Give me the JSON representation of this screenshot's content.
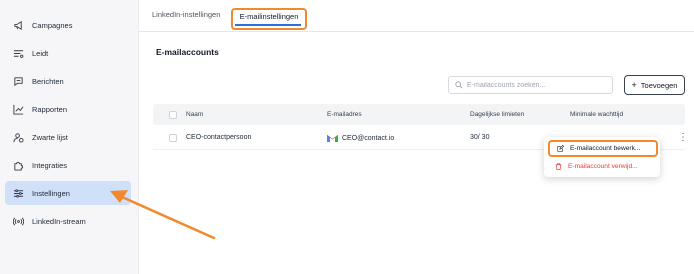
{
  "sidebar": {
    "items": [
      {
        "label": "Campagnes",
        "icon": "megaphone-icon"
      },
      {
        "label": "Leidt",
        "icon": "list-filter-icon"
      },
      {
        "label": "Berichten",
        "icon": "chat-bubble-icon"
      },
      {
        "label": "Rapporten",
        "icon": "chart-icon"
      },
      {
        "label": "Zwarte lijst",
        "icon": "user-block-icon"
      },
      {
        "label": "Integraties",
        "icon": "puzzle-icon"
      },
      {
        "label": "Instellingen",
        "icon": "sliders-icon",
        "active": true
      },
      {
        "label": "LinkedIn-stream",
        "icon": "broadcast-icon"
      }
    ]
  },
  "tabs": [
    {
      "label": "LinkedIn-instellingen"
    },
    {
      "label": "E-mailinstellingen",
      "active": true
    }
  ],
  "main": {
    "title": "E-mailaccounts",
    "search_placeholder": "E-mailaccounts zoeken...",
    "add_label": "Toevoegen"
  },
  "table": {
    "columns": [
      "Naam",
      "E-mailadres",
      "Dagelijkse limieten",
      "Minimale wachttijd"
    ],
    "rows": [
      {
        "name": "CEO-contactpersoon",
        "email": "CEO@contact.io",
        "daily": "30/ 30",
        "wait": ""
      }
    ]
  },
  "menu": {
    "edit": "E-mailaccount bewerk...",
    "delete": "E-mailaccount verwijd..."
  },
  "colors": {
    "highlight": "#f08a2c",
    "active_nav": "#cfe0f8",
    "accent": "#2f6fdd",
    "danger": "#e0413a"
  }
}
